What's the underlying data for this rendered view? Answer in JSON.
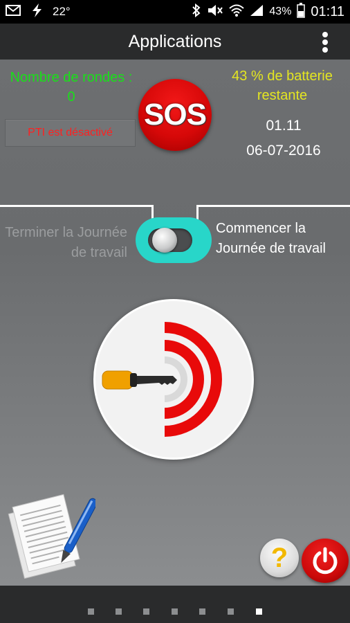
{
  "status_bar": {
    "temperature": "22°",
    "battery_percent": "43%",
    "time": "01:11",
    "icons": [
      "mail-icon",
      "flash-icon",
      "bluetooth-icon",
      "mute-icon",
      "wifi-icon",
      "signal-icon",
      "battery-icon"
    ]
  },
  "action_bar": {
    "title": "Applications",
    "overflow_icon": "more-vert-icon"
  },
  "panel": {
    "rounds_label": "Nombre de rondes :",
    "rounds_count": "0",
    "pti_status": "PTI est désactivé",
    "sos_label": "SOS",
    "battery_text": "43 % de batterie restante",
    "clock_time": "01.11",
    "clock_date": "06-07-2016"
  },
  "workday": {
    "end_label": "Terminer la Journée de travail",
    "start_label": "Commencer la Journée de travail",
    "toggle_state": "end"
  },
  "colors": {
    "green": "#19e019",
    "yellow": "#e4e621",
    "red": "#d60808",
    "teal": "#28d6c9",
    "gray_text": "#9b9d9f"
  },
  "dial": {
    "icon": "key-icon"
  },
  "bottom": {
    "document_icon": "document-pen-icon",
    "help_label": "?",
    "power_icon": "power-icon"
  },
  "pager": {
    "count": 7,
    "active_index": 6
  }
}
